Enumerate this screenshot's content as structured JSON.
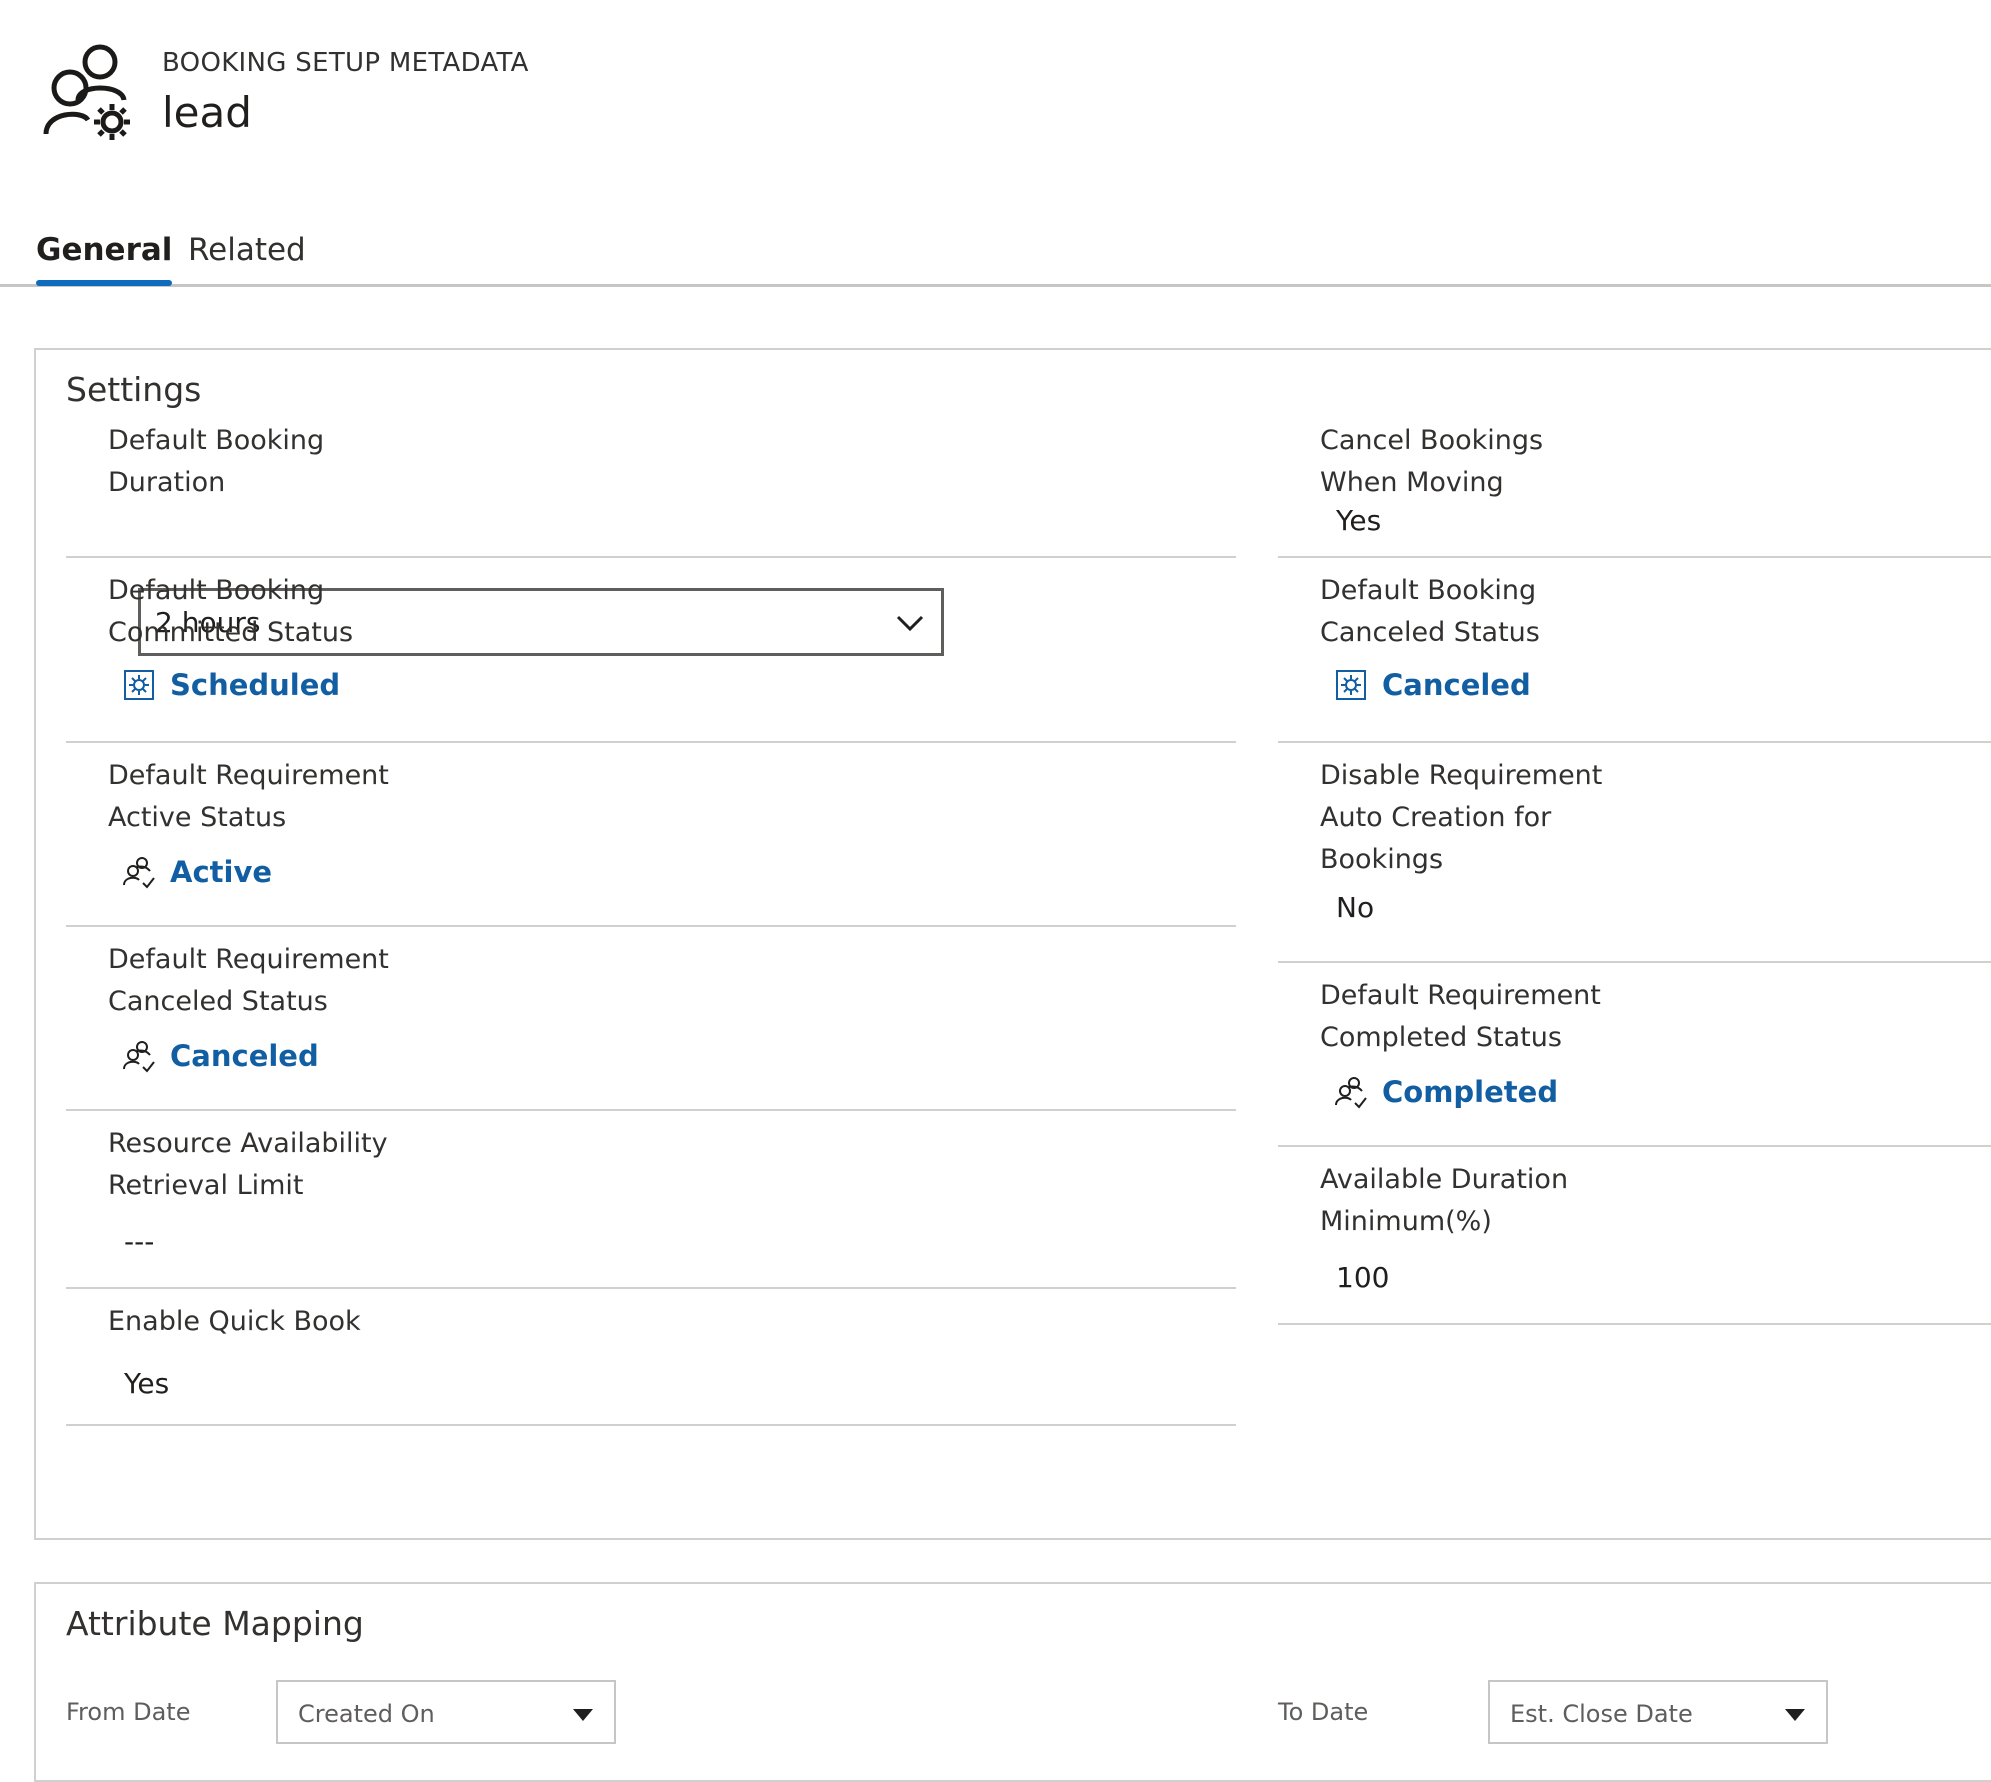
{
  "header": {
    "entity_type": "BOOKING SETUP METADATA",
    "entity_name": "lead",
    "icon": "people-gear-icon"
  },
  "tabs": [
    {
      "label": "General",
      "selected": true
    },
    {
      "label": "Related",
      "selected": false
    }
  ],
  "settings": {
    "title": "Settings",
    "left": [
      {
        "label": "Default Booking\nDuration",
        "type": "dropdown",
        "value": "2 hours"
      },
      {
        "label": "Default Booking\nCommitted Status",
        "type": "lookup",
        "value": "Scheduled",
        "icon": "booking-status-icon"
      },
      {
        "label": "Default Requirement\nActive Status",
        "type": "lookup",
        "value": "Active",
        "icon": "requirement-status-icon"
      },
      {
        "label": "Default Requirement\nCanceled Status",
        "type": "lookup",
        "value": "Canceled",
        "icon": "requirement-status-icon"
      },
      {
        "label": "Resource Availability\nRetrieval Limit",
        "type": "text",
        "value": "---"
      },
      {
        "label": "Enable Quick Book",
        "type": "text",
        "value": "Yes"
      }
    ],
    "right": [
      {
        "label": "Cancel Bookings\nWhen Moving",
        "type": "text",
        "value": "Yes"
      },
      {
        "label": "Default Booking\nCanceled Status",
        "type": "lookup",
        "value": "Canceled",
        "icon": "booking-status-icon"
      },
      {
        "label": "Disable Requirement\nAuto Creation for\nBookings",
        "type": "text",
        "value": "No"
      },
      {
        "label": "Default Requirement\nCompleted Status",
        "type": "lookup",
        "value": "Completed",
        "icon": "requirement-status-icon"
      },
      {
        "label": "Available Duration\nMinimum(%)",
        "type": "text",
        "value": "100"
      }
    ]
  },
  "attribute_mapping": {
    "title": "Attribute Mapping",
    "from_label": "From Date",
    "from_value": "Created On",
    "to_label": "To Date",
    "to_value": "Est. Close Date"
  },
  "colors": {
    "accent": "#0f6cbd",
    "link": "#115ea3",
    "border": "#d2d0ce"
  }
}
